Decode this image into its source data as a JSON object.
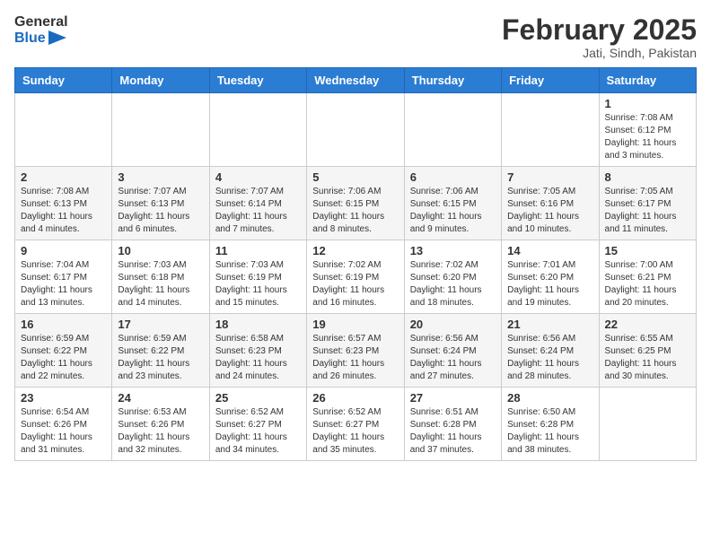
{
  "header": {
    "logo_general": "General",
    "logo_blue": "Blue",
    "month_year": "February 2025",
    "location": "Jati, Sindh, Pakistan"
  },
  "weekdays": [
    "Sunday",
    "Monday",
    "Tuesday",
    "Wednesday",
    "Thursday",
    "Friday",
    "Saturday"
  ],
  "weeks": [
    [
      {
        "day": "",
        "info": ""
      },
      {
        "day": "",
        "info": ""
      },
      {
        "day": "",
        "info": ""
      },
      {
        "day": "",
        "info": ""
      },
      {
        "day": "",
        "info": ""
      },
      {
        "day": "",
        "info": ""
      },
      {
        "day": "1",
        "info": "Sunrise: 7:08 AM\nSunset: 6:12 PM\nDaylight: 11 hours\nand 3 minutes."
      }
    ],
    [
      {
        "day": "2",
        "info": "Sunrise: 7:08 AM\nSunset: 6:13 PM\nDaylight: 11 hours\nand 4 minutes."
      },
      {
        "day": "3",
        "info": "Sunrise: 7:07 AM\nSunset: 6:13 PM\nDaylight: 11 hours\nand 6 minutes."
      },
      {
        "day": "4",
        "info": "Sunrise: 7:07 AM\nSunset: 6:14 PM\nDaylight: 11 hours\nand 7 minutes."
      },
      {
        "day": "5",
        "info": "Sunrise: 7:06 AM\nSunset: 6:15 PM\nDaylight: 11 hours\nand 8 minutes."
      },
      {
        "day": "6",
        "info": "Sunrise: 7:06 AM\nSunset: 6:15 PM\nDaylight: 11 hours\nand 9 minutes."
      },
      {
        "day": "7",
        "info": "Sunrise: 7:05 AM\nSunset: 6:16 PM\nDaylight: 11 hours\nand 10 minutes."
      },
      {
        "day": "8",
        "info": "Sunrise: 7:05 AM\nSunset: 6:17 PM\nDaylight: 11 hours\nand 11 minutes."
      }
    ],
    [
      {
        "day": "9",
        "info": "Sunrise: 7:04 AM\nSunset: 6:17 PM\nDaylight: 11 hours\nand 13 minutes."
      },
      {
        "day": "10",
        "info": "Sunrise: 7:03 AM\nSunset: 6:18 PM\nDaylight: 11 hours\nand 14 minutes."
      },
      {
        "day": "11",
        "info": "Sunrise: 7:03 AM\nSunset: 6:19 PM\nDaylight: 11 hours\nand 15 minutes."
      },
      {
        "day": "12",
        "info": "Sunrise: 7:02 AM\nSunset: 6:19 PM\nDaylight: 11 hours\nand 16 minutes."
      },
      {
        "day": "13",
        "info": "Sunrise: 7:02 AM\nSunset: 6:20 PM\nDaylight: 11 hours\nand 18 minutes."
      },
      {
        "day": "14",
        "info": "Sunrise: 7:01 AM\nSunset: 6:20 PM\nDaylight: 11 hours\nand 19 minutes."
      },
      {
        "day": "15",
        "info": "Sunrise: 7:00 AM\nSunset: 6:21 PM\nDaylight: 11 hours\nand 20 minutes."
      }
    ],
    [
      {
        "day": "16",
        "info": "Sunrise: 6:59 AM\nSunset: 6:22 PM\nDaylight: 11 hours\nand 22 minutes."
      },
      {
        "day": "17",
        "info": "Sunrise: 6:59 AM\nSunset: 6:22 PM\nDaylight: 11 hours\nand 23 minutes."
      },
      {
        "day": "18",
        "info": "Sunrise: 6:58 AM\nSunset: 6:23 PM\nDaylight: 11 hours\nand 24 minutes."
      },
      {
        "day": "19",
        "info": "Sunrise: 6:57 AM\nSunset: 6:23 PM\nDaylight: 11 hours\nand 26 minutes."
      },
      {
        "day": "20",
        "info": "Sunrise: 6:56 AM\nSunset: 6:24 PM\nDaylight: 11 hours\nand 27 minutes."
      },
      {
        "day": "21",
        "info": "Sunrise: 6:56 AM\nSunset: 6:24 PM\nDaylight: 11 hours\nand 28 minutes."
      },
      {
        "day": "22",
        "info": "Sunrise: 6:55 AM\nSunset: 6:25 PM\nDaylight: 11 hours\nand 30 minutes."
      }
    ],
    [
      {
        "day": "23",
        "info": "Sunrise: 6:54 AM\nSunset: 6:26 PM\nDaylight: 11 hours\nand 31 minutes."
      },
      {
        "day": "24",
        "info": "Sunrise: 6:53 AM\nSunset: 6:26 PM\nDaylight: 11 hours\nand 32 minutes."
      },
      {
        "day": "25",
        "info": "Sunrise: 6:52 AM\nSunset: 6:27 PM\nDaylight: 11 hours\nand 34 minutes."
      },
      {
        "day": "26",
        "info": "Sunrise: 6:52 AM\nSunset: 6:27 PM\nDaylight: 11 hours\nand 35 minutes."
      },
      {
        "day": "27",
        "info": "Sunrise: 6:51 AM\nSunset: 6:28 PM\nDaylight: 11 hours\nand 37 minutes."
      },
      {
        "day": "28",
        "info": "Sunrise: 6:50 AM\nSunset: 6:28 PM\nDaylight: 11 hours\nand 38 minutes."
      },
      {
        "day": "",
        "info": ""
      }
    ]
  ]
}
